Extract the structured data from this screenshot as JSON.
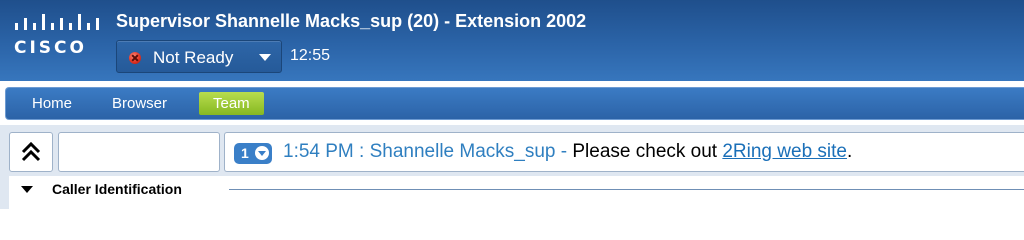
{
  "header": {
    "logo_text": "CISCO",
    "title": "Supervisor Shannelle Macks_sup (20) - Extension 2002",
    "status": {
      "label": "Not Ready",
      "icon": "not-ready-icon",
      "color": "#e33424"
    },
    "time": "12:55"
  },
  "nav": {
    "tabs": [
      {
        "label": "Home",
        "active": false
      },
      {
        "label": "Browser",
        "active": false
      },
      {
        "label": "Team",
        "active": true
      }
    ],
    "active_color": "#9ccb35"
  },
  "toolbar": {
    "collapse_icon": "double-chevron-up-icon",
    "message": {
      "count": "1",
      "meta": "1:54 PM : Shannelle Macks_sup - ",
      "body": "Please check out ",
      "link": "2Ring web site",
      "end": "."
    }
  },
  "section": {
    "title": "Caller Identification",
    "icon": "caret-down-icon"
  }
}
